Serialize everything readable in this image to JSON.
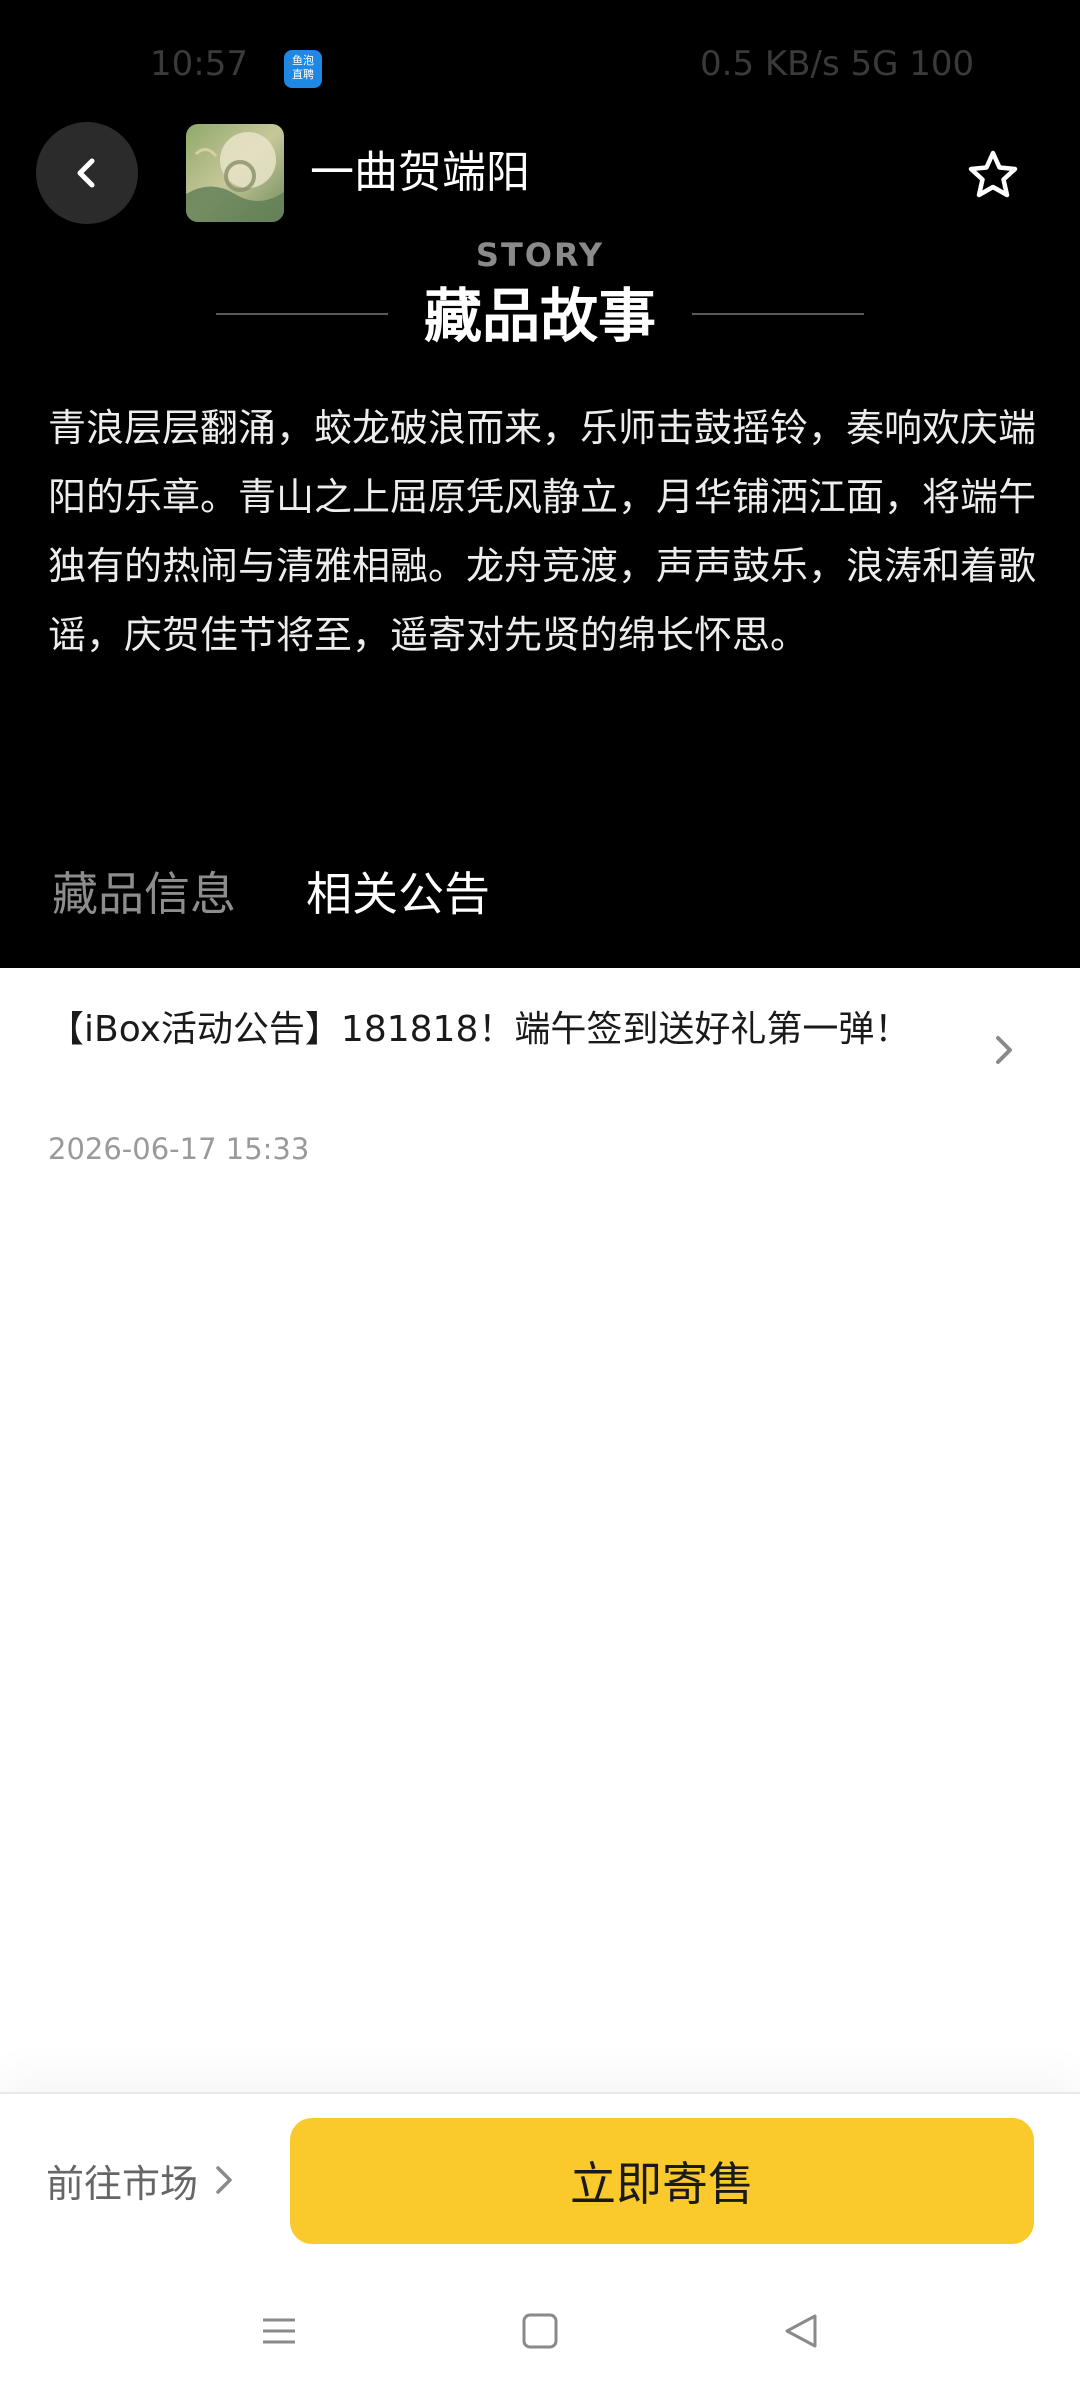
{
  "status_bar": {
    "left_text": "10:57",
    "badge_text": "鱼泡\n直聘",
    "right_text": "0.5 KB/s   5G   100"
  },
  "header": {
    "title": "一曲贺端阳",
    "back_icon": "chevron-left-icon",
    "favorite_icon": "star-outline-icon"
  },
  "story": {
    "eyebrow": "STORY",
    "title": "藏品故事",
    "body": "青浪层层翻涌，蛟龙破浪而来，乐师击鼓摇铃，奏响欢庆端阳的乐章。青山之上屈原凭风静立，月华铺洒江面，将端午独有的热闹与清雅相融。龙舟竞渡，声声鼓乐，浪涛和着歌谣，庆贺佳节将至，遥寄对先贤的绵长怀思。"
  },
  "tabs": [
    {
      "label": "藏品信息",
      "active": false
    },
    {
      "label": "相关公告",
      "active": true
    }
  ],
  "notices": [
    {
      "title": "【iBox活动公告】181818！端午签到送好礼第一弹！",
      "date": "2026-06-17 15:33"
    }
  ],
  "actions": {
    "market_label": "前往市场",
    "sell_label": "立即寄售"
  },
  "colors": {
    "dark_bg": "#000000",
    "accent_yellow": "#fac92c"
  }
}
